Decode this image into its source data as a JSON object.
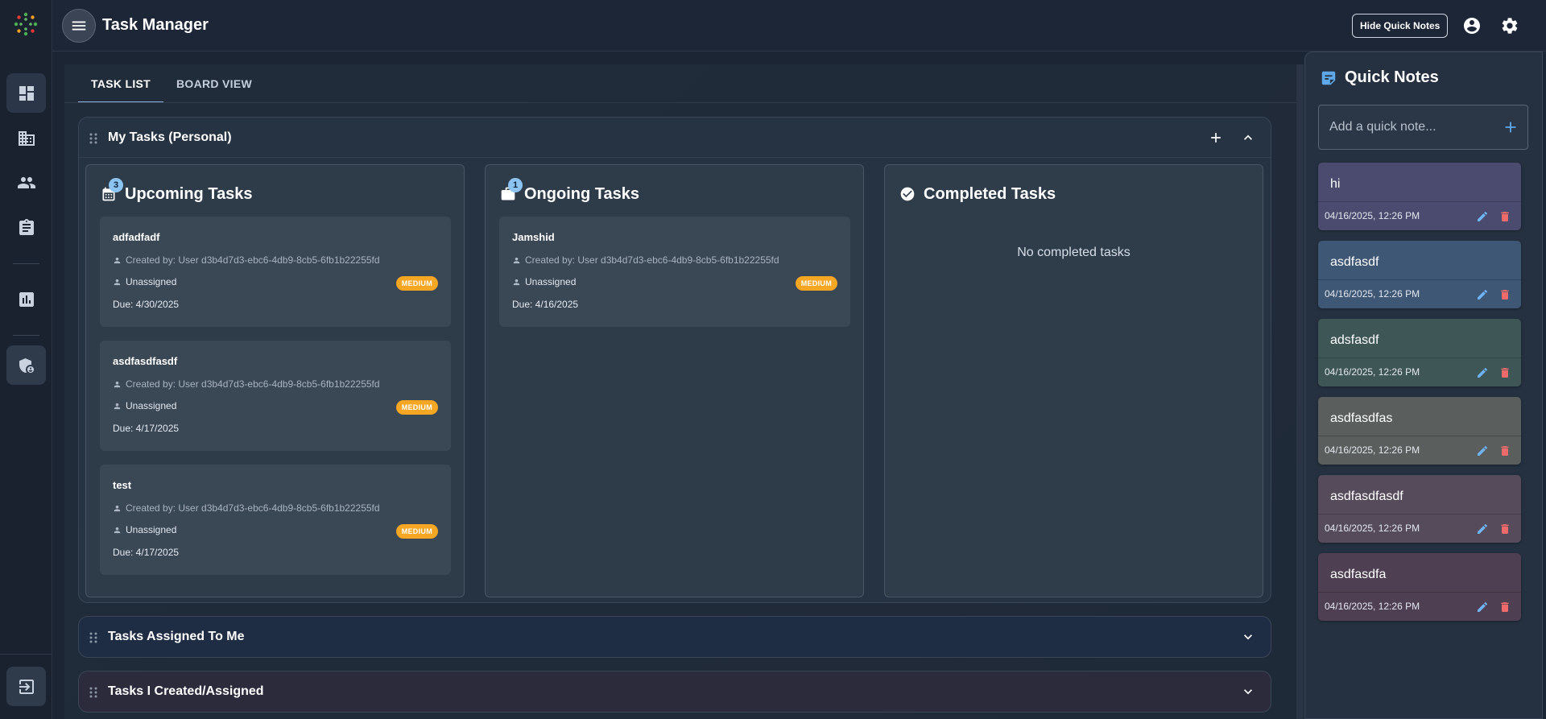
{
  "app": {
    "title": "Task Manager"
  },
  "topbar": {
    "hide_notes_label": "Hide Quick Notes"
  },
  "tabs": [
    {
      "label": "TASK LIST",
      "active": true
    },
    {
      "label": "BOARD VIEW",
      "active": false
    }
  ],
  "groups": {
    "personal": {
      "title": "My Tasks (Personal)",
      "columns": {
        "upcoming": {
          "title": "Upcoming Tasks",
          "count": "3",
          "tasks": [
            {
              "title": "adfadfadf",
              "created_by": "Created by: User d3b4d7d3-ebc6-4db9-8cb5-6fb1b22255fd",
              "assignee": "Unassigned",
              "priority": "MEDIUM",
              "due": "Due: 4/30/2025"
            },
            {
              "title": "asdfasdfasdf",
              "created_by": "Created by: User d3b4d7d3-ebc6-4db9-8cb5-6fb1b22255fd",
              "assignee": "Unassigned",
              "priority": "MEDIUM",
              "due": "Due: 4/17/2025"
            },
            {
              "title": "test",
              "created_by": "Created by: User d3b4d7d3-ebc6-4db9-8cb5-6fb1b22255fd",
              "assignee": "Unassigned",
              "priority": "MEDIUM",
              "due": "Due: 4/17/2025"
            }
          ]
        },
        "ongoing": {
          "title": "Ongoing Tasks",
          "count": "1",
          "tasks": [
            {
              "title": "Jamshid",
              "created_by": "Created by: User d3b4d7d3-ebc6-4db9-8cb5-6fb1b22255fd",
              "assignee": "Unassigned",
              "priority": "MEDIUM",
              "due": "Due: 4/16/2025"
            }
          ]
        },
        "completed": {
          "title": "Completed Tasks",
          "empty_text": "No completed tasks"
        }
      }
    },
    "assigned": {
      "title": "Tasks Assigned To Me"
    },
    "created": {
      "title": "Tasks I Created/Assigned"
    }
  },
  "quick_notes": {
    "title": "Quick Notes",
    "input_placeholder": "Add a quick note...",
    "notes": [
      {
        "text": "hi",
        "time": "04/16/2025, 12:26 PM",
        "color": "#4a4b6e"
      },
      {
        "text": "asdfasdf",
        "time": "04/16/2025, 12:26 PM",
        "color": "#3e5775"
      },
      {
        "text": "adsfasdf",
        "time": "04/16/2025, 12:26 PM",
        "color": "#3f5656"
      },
      {
        "text": "asdfasdfas",
        "time": "04/16/2025, 12:26 PM",
        "color": "#5a5f5d"
      },
      {
        "text": "asdfasdfasdf",
        "time": "04/16/2025, 12:26 PM",
        "color": "#564b5b"
      },
      {
        "text": "asdfasdfa",
        "time": "04/16/2025, 12:26 PM",
        "color": "#4f3f52"
      }
    ]
  },
  "icons": {
    "rail": [
      "dashboard-icon",
      "business-icon",
      "people-icon",
      "clipboard-icon",
      "analytics-icon",
      "shield-user-icon",
      "logout-icon"
    ],
    "topbar": [
      "menu-icon",
      "account-circle-icon",
      "settings-icon"
    ]
  },
  "colors": {
    "accent": "#5ea8ea",
    "priority_medium": "#f5a623",
    "count_badge": "#8cc3f0",
    "delete": "#ef6b6b"
  }
}
